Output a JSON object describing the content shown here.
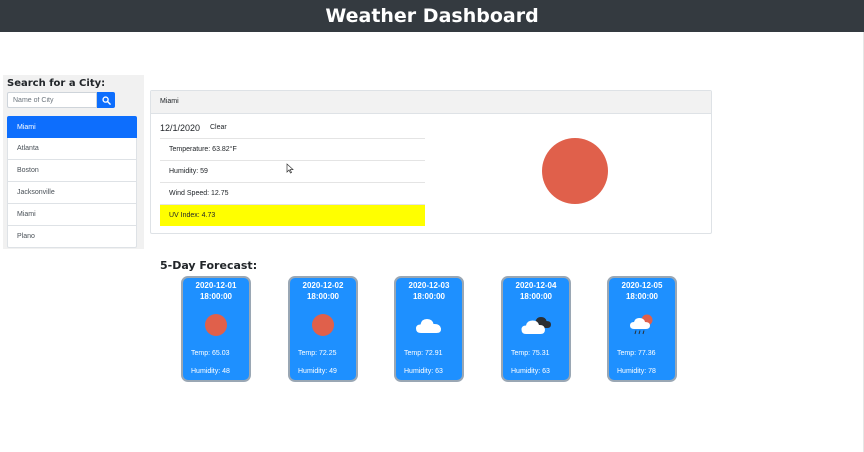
{
  "app": {
    "title": "Weather Dashboard"
  },
  "sidebar": {
    "title": "Search for a City:",
    "search_placeholder": "Name of City",
    "cities": [
      "Miami",
      "Atlanta",
      "Boston",
      "Jacksonville",
      "Miami",
      "Plano"
    ],
    "active_index": 0
  },
  "current": {
    "city": "Miami",
    "date": "12/1/2020",
    "clear_label": "Clear",
    "temperature": "Temperature: 63.82°F",
    "humidity": "Humidity: 59",
    "wind": "Wind Speed: 12.75",
    "uv": "UV Index: 4.73",
    "uv_color": "#ffff00",
    "icon": "sun-icon"
  },
  "forecast": {
    "title": "5-Day Forecast:",
    "days": [
      {
        "date": "2020-12-01",
        "time": "18:00:00",
        "icon": "sun-icon",
        "temp": "Temp: 65.03",
        "humidity": "Humidity: 48"
      },
      {
        "date": "2020-12-02",
        "time": "18:00:00",
        "icon": "sun-icon",
        "temp": "Temp: 72.25",
        "humidity": "Humidity: 49"
      },
      {
        "date": "2020-12-03",
        "time": "18:00:00",
        "icon": "cloud-icon",
        "temp": "Temp: 72.91",
        "humidity": "Humidity: 63"
      },
      {
        "date": "2020-12-04",
        "time": "18:00:00",
        "icon": "broken-clouds-icon",
        "temp": "Temp: 75.31",
        "humidity": "Humidity: 63"
      },
      {
        "date": "2020-12-05",
        "time": "18:00:00",
        "icon": "rain-sun-icon",
        "temp": "Temp: 77.36",
        "humidity": "Humidity: 78"
      }
    ]
  },
  "colors": {
    "header_bg": "#343a40",
    "accent": "#0d6efd",
    "forecast_bg": "#1e90ff",
    "sun": "#e0604b"
  }
}
